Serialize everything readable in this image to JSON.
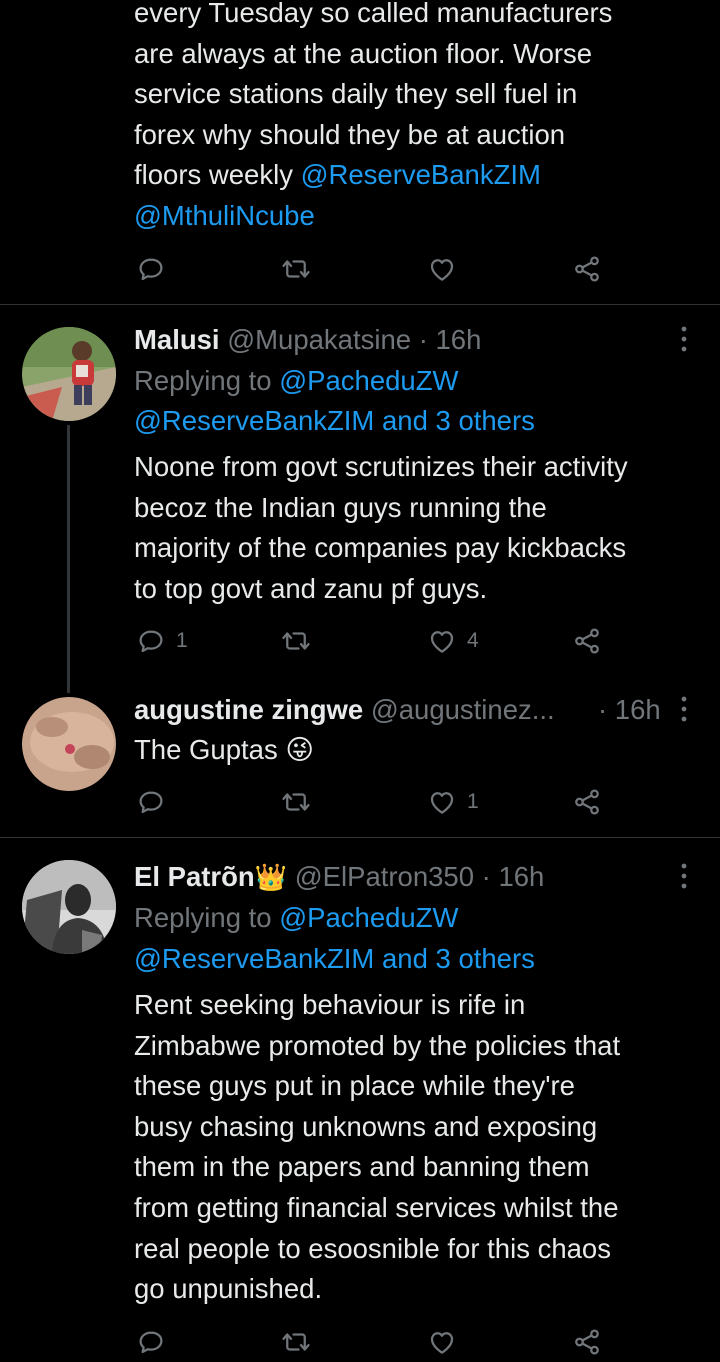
{
  "tweet0": {
    "text_lines": [
      "every Tuesday so called manufacturers",
      "are always at the auction floor. Worse",
      "service stations daily they sell fuel in",
      "forex why should they be at auction"
    ],
    "line5_text": "floors weekly ",
    "mention1": "@ReserveBankZIM",
    "mention2": "@MthuliNcube"
  },
  "tweet1": {
    "display_name": "Malusi",
    "handle": "@Mupakatsine",
    "time": "· 16h",
    "replying_prefix": "Replying to ",
    "replying_handle": "@PacheduZW",
    "replying_second": "@ReserveBankZIM and 3 others",
    "text_lines": [
      "Noone from govt scrutinizes their activity",
      "becoz the Indian guys running  the",
      "majority of the companies pay kickbacks",
      "to top govt and zanu pf guys."
    ],
    "reply_count": "1",
    "like_count": "4"
  },
  "tweet2": {
    "display_name": "augustine zingwe",
    "handle": "@augustinez...",
    "time": "· 16h",
    "text": "The Guptas",
    "emoji": "😜",
    "like_count": "1"
  },
  "tweet3": {
    "display_name": "El Patrõn",
    "crown": "👑",
    "handle": "@ElPatron350",
    "time": "· 16h",
    "replying_prefix": "Replying to ",
    "replying_handle": "@PacheduZW",
    "replying_second": "@ReserveBankZIM and 3 others",
    "text_lines": [
      "Rent seeking behaviour is rife in",
      "Zimbabwe promoted by the policies that",
      "these guys put in place while they're",
      "busy chasing unknowns and exposing",
      "them in the papers and banning them",
      "from getting financial services whilst the",
      "real people to esoosnible for this chaos",
      "go unpunished."
    ]
  },
  "icons": {
    "reply": "reply-icon",
    "retweet": "retweet-icon",
    "like": "heart-icon",
    "share": "share-icon",
    "more": "more-options-icon"
  },
  "colors": {
    "background": "#000000",
    "text": "#e7e9ea",
    "muted": "#71767b",
    "link": "#1d9bf0",
    "divider": "#2f3336"
  }
}
